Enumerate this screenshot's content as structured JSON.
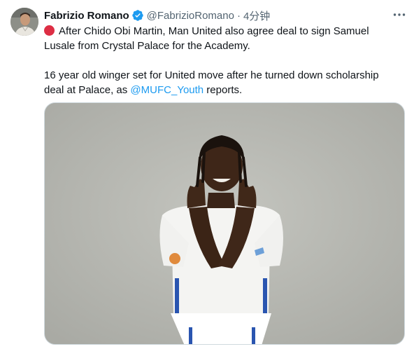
{
  "tweet": {
    "author_name": "Fabrizio Romano",
    "author_handle": "@FabrizioRomano",
    "separator": "·",
    "time": "4分钟",
    "line1": "After Chido Obi Martin, Man United also agree deal to sign Samuel Lusale from Crystal Palace for the Academy.",
    "line2_before": "16 year old winger set for United move after he turned down scholarship deal at Palace, as ",
    "mention": "@MUFC_Youth",
    "line2_after": " reports."
  },
  "icons": {
    "red_circle": "red-circle-emoji",
    "verified": "verified-badge-icon",
    "more": "more-options-icon"
  },
  "colors": {
    "link": "#1d9bf0",
    "verified": "#1d9bf0",
    "secondary_text": "#536471",
    "red_circle": "#dd2e44",
    "photo_bg": "#b9bab4"
  }
}
